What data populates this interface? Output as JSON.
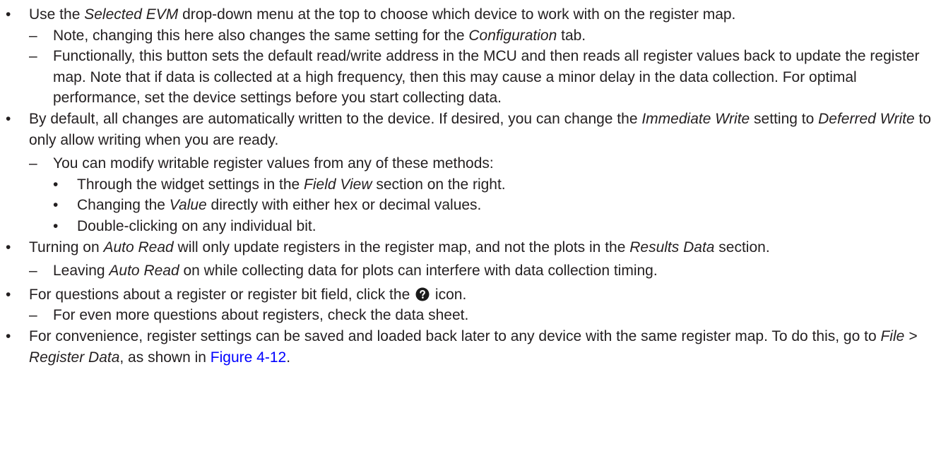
{
  "markers": {
    "bullet": "•",
    "dash": "–"
  },
  "items": [
    {
      "p1": "Use the ",
      "e1": "Selected EVM",
      "p2": " drop-down menu at the top to choose which device to work with on the register map."
    },
    {
      "p1": "Note, changing this here also changes the same setting for the ",
      "e1": "Configuration",
      "p2": " tab."
    },
    {
      "text": "Functionally, this button sets the default read/write address in the MCU and then reads all register values back to update the register map. Note that if data is collected at a high frequency, then this may cause a minor delay in the data collection. For optimal performance, set the device settings before you start collecting data."
    },
    {
      "p1": "By default, all changes are automatically written to the device. If desired, you can change the ",
      "e1": "Immediate Write",
      "p2": " setting to ",
      "e2": "Deferred Write",
      "p3": " to only allow writing when you are ready."
    },
    {
      "text": "You can modify writable register values from any of these methods:"
    },
    {
      "p1": "Through the widget settings in the ",
      "e1": "Field View",
      "p2": " section on the right."
    },
    {
      "p1": "Changing the ",
      "e1": "Value",
      "p2": " directly with either hex or decimal values."
    },
    {
      "text": "Double-clicking on any individual bit."
    },
    {
      "p1": "Turning on ",
      "e1": "Auto Read",
      "p2": " will only update registers in the register map, and not the plots in the ",
      "e2": "Results Data",
      "p3": " section."
    },
    {
      "p1": "Leaving ",
      "e1": "Auto Read",
      "p2": " on while collecting data for plots can interfere with data collection timing."
    },
    {
      "p1": "For questions about a register or register bit field, click the ",
      "p2": " icon.",
      "icon": "help-question-icon"
    },
    {
      "text": "For even more questions about registers, check the data sheet."
    },
    {
      "p1": "For convenience, register settings can be saved and loaded back later to any device with the same register map. To do this, go to ",
      "e1": "File > Register Data",
      "p2": ", as shown in ",
      "link": "Figure 4-12",
      "p3": "."
    }
  ],
  "colors": {
    "text": "#231f20",
    "link": "#0000ff",
    "icon_fill": "#1a1a1a"
  }
}
